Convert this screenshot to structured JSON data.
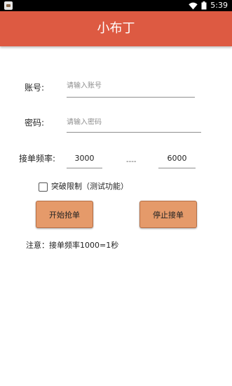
{
  "status_bar": {
    "time": "5:39",
    "icons": [
      "app-notification-icon",
      "wifi-icon",
      "battery-icon"
    ]
  },
  "app": {
    "title": "小布丁"
  },
  "form": {
    "account": {
      "label": "账号:",
      "placeholder": "请输入账号",
      "value": ""
    },
    "password": {
      "label": "密码:",
      "placeholder": "请输入密码",
      "value": ""
    },
    "frequency": {
      "label": "接单频率:",
      "min_value": "3000",
      "separator": "----",
      "max_value": "6000"
    },
    "break_limit": {
      "label": "突破限制（测试功能）",
      "checked": false
    }
  },
  "buttons": {
    "start_label": "开始抢单",
    "stop_label": "停止接单"
  },
  "note": "注意：接单频率1000=1秒",
  "colors": {
    "app_bar": "#dd5a42",
    "button": "#e59a6a",
    "status_bar": "#000000"
  }
}
